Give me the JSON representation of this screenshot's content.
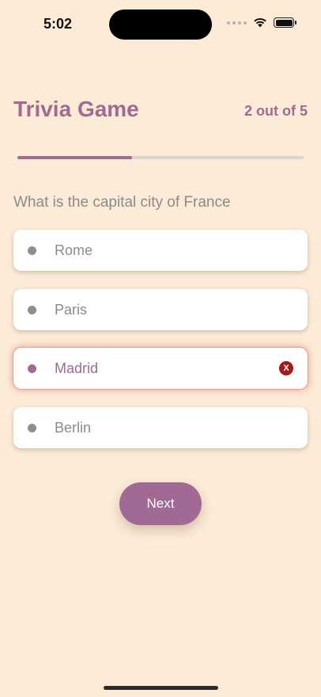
{
  "status_bar": {
    "time": "5:02"
  },
  "header": {
    "title": "Trivia Game",
    "progress_text": "2 out of 5",
    "progress_fraction": 0.4
  },
  "question": "What is the capital city of France",
  "options": [
    {
      "label": "Rome",
      "state": "default"
    },
    {
      "label": "Paris",
      "state": "default"
    },
    {
      "label": "Madrid",
      "state": "wrong",
      "badge": "X"
    },
    {
      "label": "Berlin",
      "state": "default"
    }
  ],
  "next_button": {
    "label": "Next"
  },
  "colors": {
    "background": "#fbebd7",
    "accent": "#a06a94",
    "wrong": "#a31a1a",
    "muted_text": "#8e8a87"
  }
}
